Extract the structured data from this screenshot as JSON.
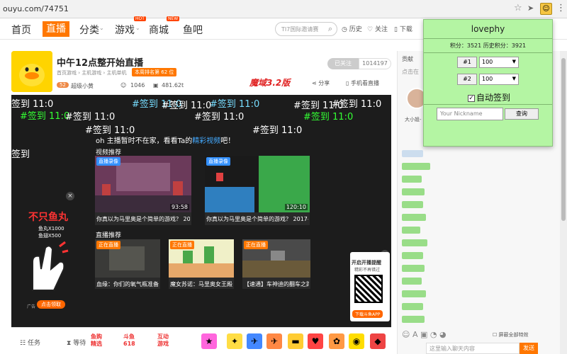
{
  "browser": {
    "url": "ouyu.com/74751"
  },
  "nav": {
    "items": [
      "首页",
      "直播",
      "分类",
      "游戏",
      "商城",
      "鱼吧"
    ],
    "hot_badge": "HOT",
    "new_badge": "NEW",
    "search_placeholder": "TI7国际邀请赛",
    "history": "历史",
    "follow": "关注",
    "download": "下载"
  },
  "room": {
    "title": "中午12点整开始直播",
    "crumbs": "首页游戏 › 主机游戏 › 主机单机",
    "rank_label": "本周排名第",
    "rank_value": "62",
    "rank_unit": "位",
    "level": "52",
    "anchor": "超级小黄",
    "fans": "1046",
    "hot": "481.62t",
    "follow_btn": "已关注",
    "follow_count": "1014197",
    "promo": "魔域3.2版",
    "share": "分享",
    "mobile": "手机看直播"
  },
  "danmaku": [
    "签到 11:0",
    "#签到 11:0",
    "#签到 11:0",
    "#签到 11:0",
    "#签到 11:0",
    "#签到 11:0",
    "#签到 11:0",
    "#签到 11:0",
    "#签到 11:0",
    "#签到 11:0",
    "#签到 11:0",
    "#签到 11:0",
    "签到"
  ],
  "player": {
    "offline_msg": "oh 主播暂时不在家，看看Ta的",
    "offline_link": "精彩视频",
    "offline_end": "吧！",
    "video_rec": "视频推荐",
    "live_rec": "直播推荐",
    "videos": [
      {
        "badge": "直播录像",
        "duration": "93:58",
        "caption": "你真以为马里奥是个简单的游戏？ 2017-..."
      },
      {
        "badge": "直播录像",
        "duration": "120:10",
        "caption": "你真以为马里奥是个简单的游戏？ 2017-..."
      }
    ],
    "lives": [
      {
        "badge": "正在直播",
        "caption": "血缘：你们的氧气瓶准备..."
      },
      {
        "badge": "正在直播",
        "caption": "魔女苏诺：马里奥女王殿..."
      },
      {
        "badge": "正在直播",
        "caption": "【速通】车神迪的翻车之路"
      }
    ],
    "ad_left_title": "不只鱼丸",
    "ad_left_sub1": "鱼丸X1000",
    "ad_left_sub2": "鱼翅X500",
    "ad_left_btn": "点击领取",
    "ad_left_tag": "广告",
    "ad_right_l1": "开启开播提醒",
    "ad_right_l2": "精彩不再错过",
    "ad_right_btn": "下载斗鱼APP"
  },
  "bottombar": {
    "task": "任务",
    "wait": "等待",
    "promo1": "鱼购\n精选",
    "promo2": "斗鱼\n618",
    "promo3": "互动\n游戏"
  },
  "chat": {
    "head": "贡献",
    "sub": "点击在",
    "anchor_name": "大小姐-",
    "block_label": "屏蔽全部特效",
    "input_placeholder": "这里输入聊天内容",
    "send": "发送"
  },
  "popup": {
    "title": "lovephy",
    "score_text": "积分：3521 历史积分：3921",
    "slot1_label": "#1",
    "slot1_value": "100",
    "slot2_label": "#2",
    "slot2_value": "100",
    "auto_sign": "自动签到",
    "nickname_placeholder": "Your Nickname",
    "query_btn": "查询"
  },
  "colors": {
    "accent": "#ff7700",
    "popup_bg": "#b4f5a3",
    "danmaku_green": "#33ff33"
  }
}
